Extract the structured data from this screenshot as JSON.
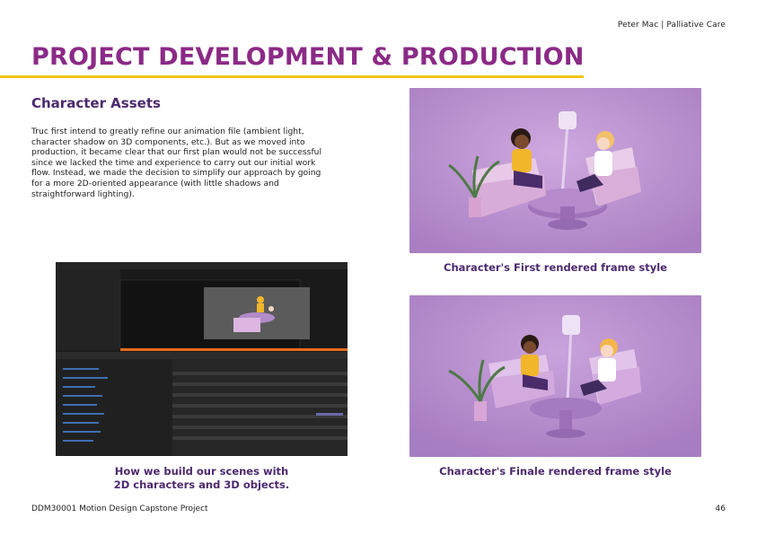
{
  "header": {
    "top_right": "Peter Mac | Palliative Care"
  },
  "title": "PROJECT DEVELOPMENT & PRODUCTION",
  "section": {
    "heading": "Character Assets",
    "body": "Truc first intend to greatly refine our animation file (ambient light, character shadow on 3D components, etc.). But as we moved into production, it became clear that our first plan would not be successful since we lacked the time and experience to carry out our initial work flow. Instead, we made the decision to simplify our approach by going for a more 2D-oriented appearance (with little shadows and straightforward lighting)."
  },
  "images": {
    "first_caption": "Character's First rendered frame style",
    "final_caption": "Character's Finale rendered frame style",
    "editor_caption_line1": "How we build our scenes with",
    "editor_caption_line2": "2D characters and 3D objects."
  },
  "footer": {
    "left": "DDM30001 Motion Design Capstone Project",
    "page_number": "46"
  },
  "colors": {
    "title": "#8b2a86",
    "heading": "#4d2a6e",
    "accent_rule": "#f2c418",
    "scene_bg": "#b88fcc"
  }
}
